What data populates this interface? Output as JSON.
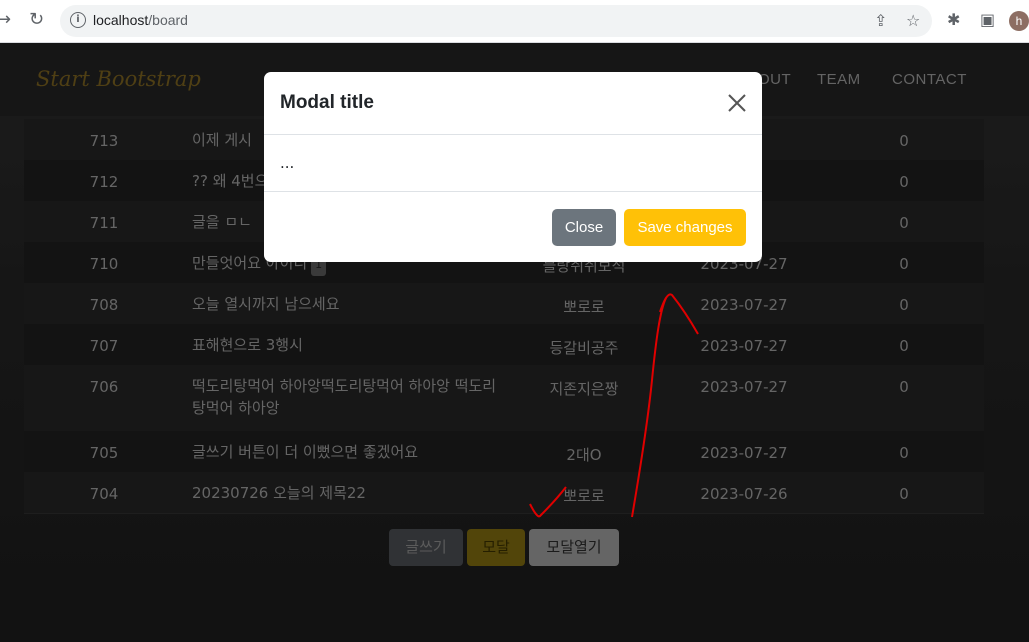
{
  "browser": {
    "url_host": "localhost",
    "url_path": "/board",
    "avatar_letter": "h"
  },
  "navbar": {
    "brand": "Start Bootstrap",
    "links": [
      "OUT",
      "TEAM",
      "CONTACT"
    ]
  },
  "rows": [
    {
      "no": "713",
      "title": "이제 게시",
      "author": "",
      "date": "-03",
      "views": "0"
    },
    {
      "no": "712",
      "title": "?? 왜 4번으",
      "author": "",
      "date": "-28",
      "views": "0"
    },
    {
      "no": "711",
      "title": "글을 ㅁㄴ",
      "author": "",
      "date": "-27",
      "views": "0"
    },
    {
      "no": "710",
      "title": "만들엇어요 아이디",
      "badge": "1",
      "author": "블랑쥐쥐보석",
      "date": "2023-07-27",
      "views": "0"
    },
    {
      "no": "708",
      "title": "오늘 열시까지 남으세요",
      "author": "뽀로로",
      "date": "2023-07-27",
      "views": "0"
    },
    {
      "no": "707",
      "title": "표해현으로 3행시",
      "author": "등갈비공주",
      "date": "2023-07-27",
      "views": "0"
    },
    {
      "no": "706",
      "title": "떡도리탕먹어 하아앙떡도리탕먹어 하아앙 떡도리탕먹어 하아앙",
      "author": "지존지은짱",
      "date": "2023-07-27",
      "views": "0"
    },
    {
      "no": "705",
      "title": "글쓰기 버튼이 더 이뻤으면 좋겠어요",
      "author": "2대O",
      "date": "2023-07-27",
      "views": "0"
    },
    {
      "no": "704",
      "title": "20230726 오늘의 제목22",
      "author": "뽀로로",
      "date": "2023-07-26",
      "views": "0"
    }
  ],
  "buttons": {
    "write": "글쓰기",
    "modal": "모달",
    "open_modal": "모달열기"
  },
  "modal": {
    "title": "Modal title",
    "body": "...",
    "close_label": "Close",
    "save_label": "Save changes"
  },
  "colors": {
    "save_button": "#ffc107",
    "close_button": "#6c757d",
    "annotation": "#e00000"
  }
}
